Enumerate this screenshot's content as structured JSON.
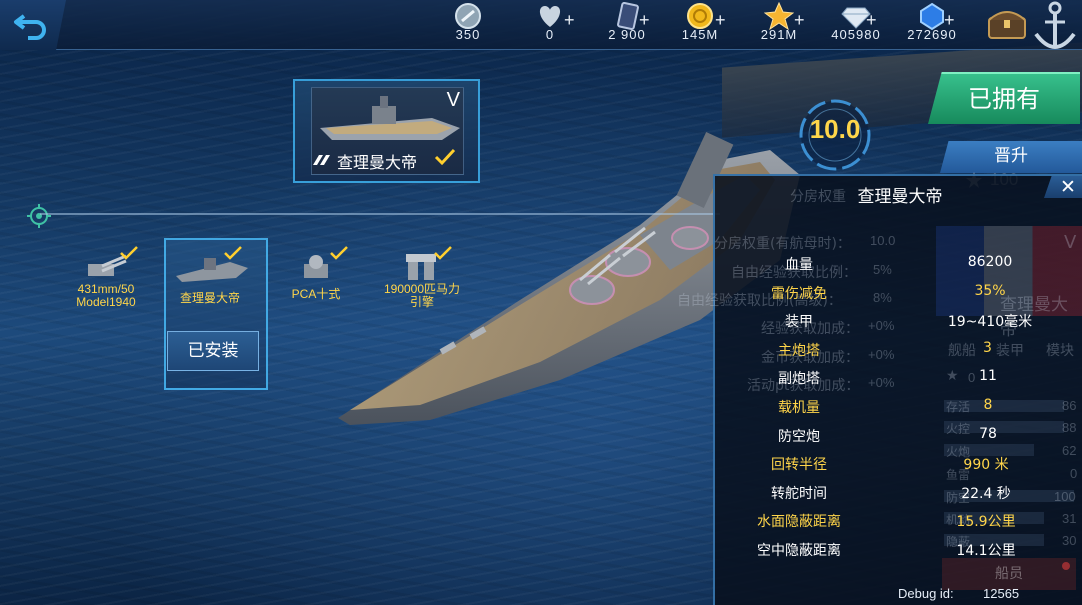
{
  "resources": [
    {
      "icon": "silver-coin-icon",
      "value": "350",
      "plus": false
    },
    {
      "icon": "heart-icon",
      "value": "0",
      "plus": true
    },
    {
      "icon": "card-icon",
      "value": "2 900",
      "plus": true
    },
    {
      "icon": "gold-coin-icon",
      "value": "145M",
      "plus": true
    },
    {
      "icon": "star-icon",
      "value": "291M",
      "plus": true
    },
    {
      "icon": "diamond-icon",
      "value": "405980",
      "plus": true
    },
    {
      "icon": "blue-gem-icon",
      "value": "272690",
      "plus": true
    }
  ],
  "ship_card": {
    "tier": "V",
    "name": "查理曼大帝"
  },
  "modules": [
    {
      "label": "431mm/50\nModel1940",
      "icon": "main-gun-icon"
    },
    {
      "label": "查理曼大帝",
      "icon": "hull-icon"
    },
    {
      "label": "PCA十式",
      "icon": "fire-control-icon"
    },
    {
      "label": "190000匹马力\n引擎",
      "icon": "engine-icon"
    }
  ],
  "installed_label": "已安装",
  "rating": "10.0",
  "owned_label": "已拥有",
  "promote_label": "晋升",
  "promote_cost": "100",
  "panel": {
    "title": "查理曼大帝",
    "ghost_name": "查理曼大帝",
    "ghost_tier": "V",
    "ghost_tabs": [
      "舰船",
      "装甲",
      "模块"
    ],
    "ghost_rows": [
      {
        "label": "分房权重(有航母时)：",
        "value": "10.0"
      },
      {
        "label": "自由经验获取比例：",
        "value": "5%"
      },
      {
        "label": "自由经验获取比例(高级)：",
        "value": "8%"
      },
      {
        "label": "经验获取加成：",
        "value": "+0%"
      },
      {
        "label": "金币获取加成：",
        "value": "+0%"
      },
      {
        "label": "活动pt获取加成：",
        "value": "+0%"
      }
    ],
    "ghost_top": "分房权重",
    "ghost_side": [
      {
        "label": "存活",
        "value": "86"
      },
      {
        "label": "火控",
        "value": "88"
      },
      {
        "label": "火炮",
        "value": "62"
      },
      {
        "label": "鱼雷",
        "value": "0"
      },
      {
        "label": "防空",
        "value": "100"
      },
      {
        "label": "机动",
        "value": "31"
      },
      {
        "label": "隐蔽",
        "value": "30"
      }
    ],
    "ghost_star": "0",
    "stats": [
      {
        "label": "血量",
        "value": "86200",
        "highlight": false
      },
      {
        "label": "雷伤减免",
        "value": "35%",
        "highlight": true
      },
      {
        "label": "装甲",
        "value": "19~410毫米",
        "highlight": false
      },
      {
        "label": "主炮塔",
        "value": "3",
        "highlight": true
      },
      {
        "label": "副炮塔",
        "value": "11",
        "highlight": false
      },
      {
        "label": "载机量",
        "value": "8",
        "highlight": true
      },
      {
        "label": "防空炮",
        "value": "78",
        "highlight": false
      },
      {
        "label": "回转半径",
        "value": "990 米",
        "highlight": true
      },
      {
        "label": "转舵时间",
        "value": "22.4 秒",
        "highlight": false
      },
      {
        "label": "水面隐蔽距离",
        "value": "15.9公里",
        "highlight": true
      },
      {
        "label": "空中隐蔽距离",
        "value": "14.1公里",
        "highlight": false
      }
    ],
    "crew_label": "船员"
  },
  "debug": {
    "label": "Debug id:",
    "value": "12565"
  },
  "colors": {
    "highlight": "#ffd54a",
    "accent": "#46b4f0",
    "owned": "#1f9e6c"
  }
}
